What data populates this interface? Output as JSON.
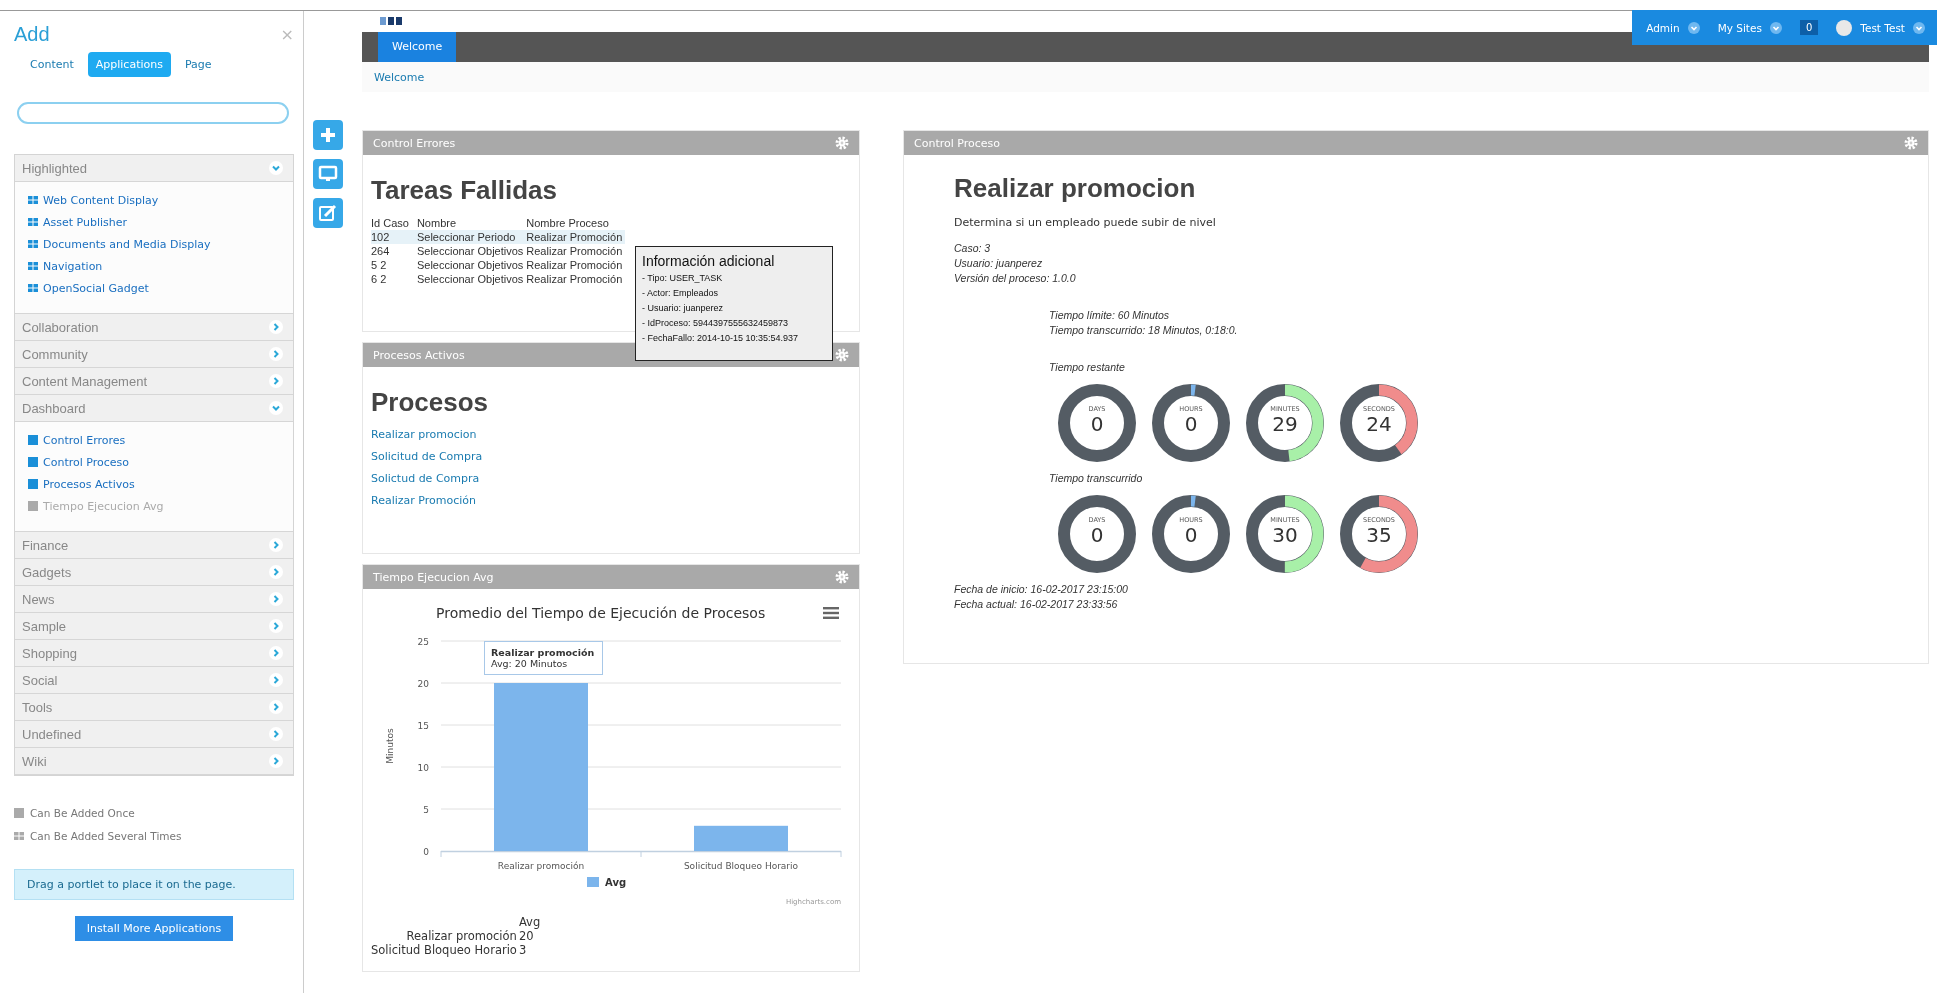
{
  "sidebar": {
    "title": "Add",
    "close": "×",
    "tabs": [
      {
        "label": "Content",
        "selected": false
      },
      {
        "label": "Applications",
        "selected": true
      },
      {
        "label": "Page",
        "selected": false
      }
    ],
    "categories": [
      {
        "label": "Highlighted",
        "expanded": true,
        "items": [
          {
            "label": "Web Content Display",
            "kind": "multi",
            "disabled": false
          },
          {
            "label": "Asset Publisher",
            "kind": "multi",
            "disabled": false
          },
          {
            "label": "Documents and Media Display",
            "kind": "multi",
            "disabled": false
          },
          {
            "label": "Navigation",
            "kind": "multi",
            "disabled": false
          },
          {
            "label": "OpenSocial Gadget",
            "kind": "multi",
            "disabled": false
          }
        ]
      },
      {
        "label": "Collaboration",
        "expanded": false
      },
      {
        "label": "Community",
        "expanded": false
      },
      {
        "label": "Content Management",
        "expanded": false
      },
      {
        "label": "Dashboard",
        "expanded": true,
        "items": [
          {
            "label": "Control Errores",
            "kind": "once",
            "disabled": false
          },
          {
            "label": "Control Proceso",
            "kind": "once",
            "disabled": false
          },
          {
            "label": "Procesos Activos",
            "kind": "once",
            "disabled": false
          },
          {
            "label": "Tiempo Ejecucion Avg",
            "kind": "once",
            "disabled": true
          }
        ]
      },
      {
        "label": "Finance",
        "expanded": false
      },
      {
        "label": "Gadgets",
        "expanded": false
      },
      {
        "label": "News",
        "expanded": false
      },
      {
        "label": "Sample",
        "expanded": false
      },
      {
        "label": "Shopping",
        "expanded": false
      },
      {
        "label": "Social",
        "expanded": false
      },
      {
        "label": "Tools",
        "expanded": false
      },
      {
        "label": "Undefined",
        "expanded": false
      },
      {
        "label": "Wiki",
        "expanded": false
      }
    ],
    "legend": [
      {
        "kind": "once",
        "label": "Can Be Added Once"
      },
      {
        "kind": "multi",
        "label": "Can Be Added Several Times"
      }
    ],
    "hint": "Drag a portlet to place it on the page.",
    "install_button": "Install More Applications"
  },
  "admin_bar": [
    {
      "kind": "menu",
      "label": "Admin"
    },
    {
      "kind": "menu",
      "label": "My Sites"
    },
    {
      "kind": "count",
      "label": "0"
    },
    {
      "kind": "user",
      "label": "Test Test"
    }
  ],
  "nav_tabs": [
    {
      "label": "Welcome",
      "selected": true
    }
  ],
  "breadcrumb": [
    "Welcome"
  ],
  "columns": [
    [
      {
        "kind": "failed_tasks",
        "header": "Control Errores",
        "title": "Tareas Fallidas",
        "table": {
          "columns": [
            "Id Caso",
            "Nombre",
            "Nombre Proceso"
          ],
          "rows": [
            {
              "cells": [
                "102",
                "Seleccionar Periodo",
                "Realizar Promoción"
              ],
              "selected": true
            },
            {
              "cells": [
                "264",
                "Seleccionar Objetivos",
                "Realizar Promoción"
              ],
              "selected": false
            },
            {
              "cells": [
                "5  2",
                "Seleccionar Objetivos",
                "Realizar Promoción"
              ],
              "selected": false
            },
            {
              "cells": [
                "6  2",
                "Seleccionar Objetivos",
                "Realizar Promoción"
              ],
              "selected": false
            }
          ]
        },
        "tooltip": {
          "title": "Información adicional",
          "lines": [
            "- Tipo: USER_TASK",
            "- Actor: Empleados",
            "- Usuario: juanperez",
            "- IdProceso: 5944397555632459873",
            "- FechaFallo: 2014-10-15 10:35:54.937"
          ]
        }
      },
      {
        "kind": "process_list",
        "header": "Procesos Activos",
        "title": "Procesos",
        "links": [
          "Realizar promocion",
          "Solicitud de Compra",
          "Solictud de Compra",
          "Realizar Promoción"
        ]
      },
      {
        "kind": "chart",
        "header": "Tiempo Ejecucion Avg",
        "chart_data": {
          "type": "bar",
          "title": "Promedio del Tiempo de Ejecución de Procesos",
          "ylabel": "Minutos",
          "categories": [
            "Realizar promoción",
            "Solicitud Bloqueo Horario"
          ],
          "series": [
            {
              "name": "Avg",
              "color": "#7cb5ec",
              "values": [
                20,
                3
              ]
            }
          ],
          "ylim": [
            0,
            25
          ],
          "yticks": [
            0,
            5,
            10,
            15,
            20,
            25
          ],
          "grid": true
        },
        "tooltip": {
          "title": "Realizar promoción",
          "text": "Avg: 20 Minutos"
        },
        "credit": "Highcharts.com",
        "data_table": {
          "header": "Avg",
          "rows": [
            [
              "Realizar promoción",
              "20"
            ],
            [
              "Solicitud Bloqueo Horario",
              "3"
            ]
          ]
        }
      }
    ],
    [
      {
        "kind": "process_detail",
        "header": "Control Proceso",
        "title": "Realizar promocion",
        "description": "Determina si un empleado puede subir de nivel",
        "info": [
          "Caso: 3",
          "Usuario: juanperez",
          "Versión del proceso: 1.0.0"
        ],
        "times": [
          "Tiempo límite: 60 Minutos",
          "Tiempo transcurrido: 18 Minutos, 0:18:0."
        ],
        "timers": [
          {
            "label": "Tiempo restante",
            "dials": [
              {
                "unit": "DAYS",
                "value": "0",
                "level": 0
              },
              {
                "unit": "HOURS",
                "value": "0",
                "level": 0.02,
                "color": "#7cb5ec"
              },
              {
                "unit": "MINUTES",
                "value": "29",
                "level": 0.48,
                "color": "#a8f0a8"
              },
              {
                "unit": "SECONDS",
                "value": "24",
                "level": 0.4,
                "color": "#f08c8c"
              }
            ]
          },
          {
            "label": "Tiempo transcurrido",
            "dials": [
              {
                "unit": "DAYS",
                "value": "0",
                "level": 0
              },
              {
                "unit": "HOURS",
                "value": "0",
                "level": 0.02,
                "color": "#7cb5ec"
              },
              {
                "unit": "MINUTES",
                "value": "30",
                "level": 0.5,
                "color": "#a8f0a8"
              },
              {
                "unit": "SECONDS",
                "value": "35",
                "level": 0.58,
                "color": "#f08c8c"
              }
            ]
          }
        ],
        "dates": [
          "Fecha de inicio: 16-02-2017 23:15:00",
          "Fecha actual: 16-02-2017 23:33:56"
        ]
      }
    ]
  ]
}
